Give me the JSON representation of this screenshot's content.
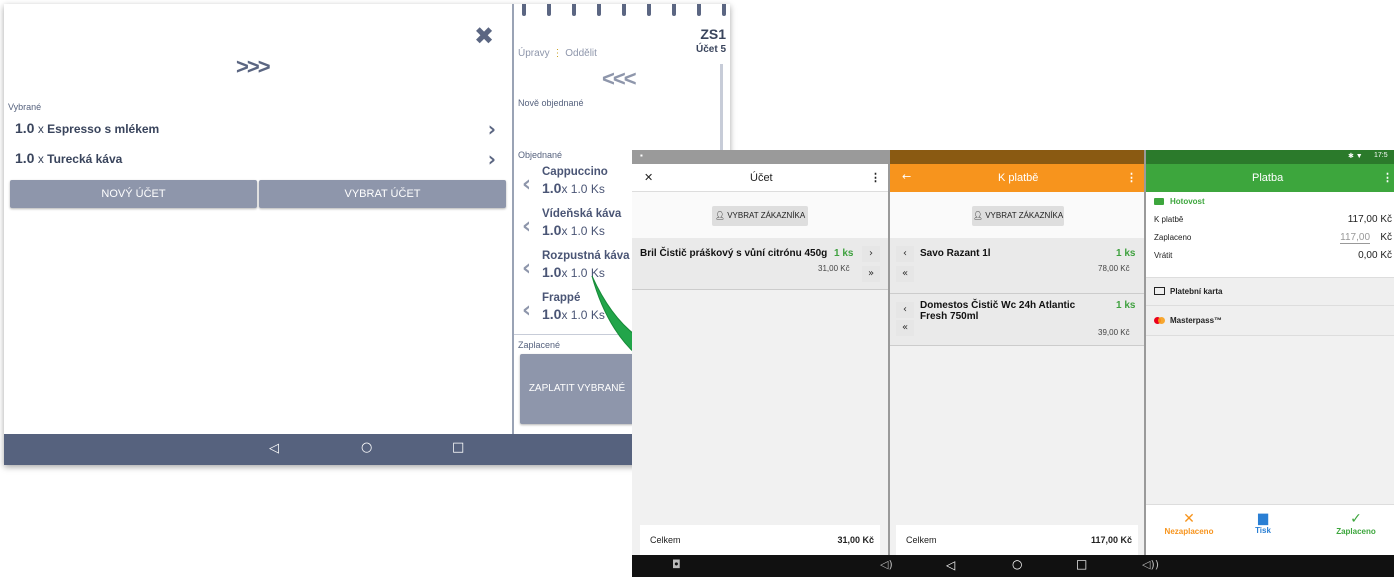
{
  "tablet1": {
    "close_symbol": "✖",
    "forward_arrows": ">>>",
    "selected_label": "Vybrané",
    "selected_items": [
      {
        "qty": "1.0",
        "x": "x",
        "name": "Espresso s mlékem"
      },
      {
        "qty": "1.0",
        "x": "x",
        "name": "Turecká káva"
      }
    ],
    "new_account_button": "NOVÝ ÚČET",
    "choose_account_button": "VYBRAT ÚČET",
    "table_code": "ZS1",
    "account_label": "Účet 5",
    "tab_edits": "Úpravy",
    "tab_split": "Oddělit",
    "back_arrows": "<<<",
    "new_ordered_label": "Nově objednané",
    "ordered_label": "Objednané",
    "ordered_items": [
      {
        "name": "Cappuccino",
        "qty": "1.0",
        "unit": "x 1.0 Ks"
      },
      {
        "name": "Vídeňská káva",
        "qty": "1.0",
        "unit": "x 1.0 Ks"
      },
      {
        "name": "Rozpustná káva",
        "qty": "1.0",
        "unit": "x 1.0 Ks"
      },
      {
        "name": "Frappé",
        "qty": "1.0",
        "unit": "x 1.0 Ks"
      }
    ],
    "paid_label": "Zaplacené",
    "pay_selected_button": "ZAPLATIT VYBRANÉ",
    "nav": {
      "back": "◁",
      "home": "○",
      "recent": "□"
    }
  },
  "tablet2": {
    "status_time": "17:5",
    "status_icons": "✱ ▼",
    "account_panel": {
      "title": "Účet",
      "close": "✕",
      "menu": "⋮",
      "customer_button": "VYBRAT ZÁKAZNÍKA",
      "items": [
        {
          "name": "Bril Čistič práškový s vůní citrónu 450g",
          "qty": "1 ks",
          "price": "31,00 Kč"
        }
      ],
      "total_label": "Celkem",
      "total_value": "31,00 Kč"
    },
    "topay_panel": {
      "title": "K platbě",
      "back": "←",
      "menu": "⋮",
      "customer_button": "VYBRAT ZÁKAZNÍKA",
      "items": [
        {
          "name": "Savo Razant 1l",
          "qty": "1 ks",
          "price": "78,00 Kč"
        },
        {
          "name": "Domestos Čistič Wc 24h Atlantic Fresh 750ml",
          "qty": "1 ks",
          "price": "39,00 Kč"
        }
      ],
      "total_label": "Celkem",
      "total_value": "117,00 Kč"
    },
    "payment_panel": {
      "title": "Platba",
      "menu": "⋮",
      "cash_label": "Hotovost",
      "to_pay_label": "K platbě",
      "to_pay_value": "117,00 Kč",
      "paid_label": "Zaplaceno",
      "paid_value": "117,00",
      "paid_currency": "Kč",
      "change_label": "Vrátit",
      "change_value": "0,00 Kč",
      "card_label": "Platební karta",
      "masterpass_label": "Masterpass™",
      "unpaid_button": "Nezaplaceno",
      "print_button": "Tisk",
      "paid_button": "Zaplaceno"
    },
    "colors": {
      "account": "#ffffff",
      "topay": "#f7941d",
      "payment": "#3da63d"
    },
    "nav": {
      "back": "◁",
      "home": "○",
      "recent": "□",
      "vol_down": "◁)",
      "vol_up": "◁))",
      "screenshot": "◘"
    }
  }
}
